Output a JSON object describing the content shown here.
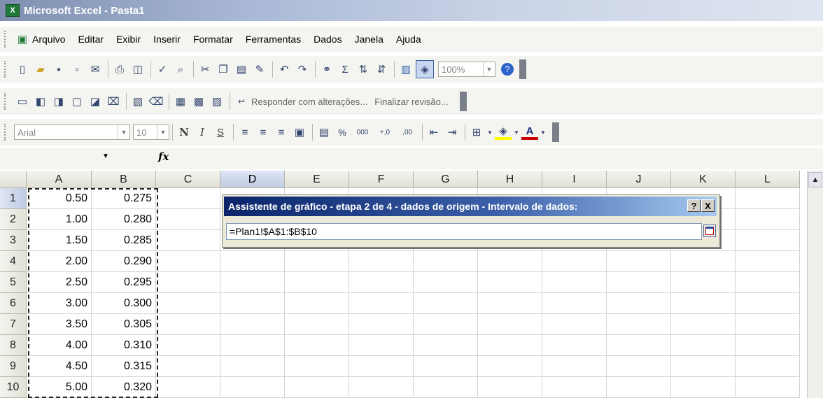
{
  "window": {
    "title": "Microsoft Excel - Pasta1",
    "app_icon": "X"
  },
  "menu": [
    "Arquivo",
    "Editar",
    "Exibir",
    "Inserir",
    "Formatar",
    "Ferramentas",
    "Dados",
    "Janela",
    "Ajuda"
  ],
  "toolbar": {
    "zoom": "100%",
    "review_reply": "Responder com alterações...",
    "review_end": "Finalizar revisão...",
    "font_name": "Arial",
    "font_size": "10",
    "bold": "N",
    "italic": "I",
    "underline": "S",
    "percent": "%",
    "thousands": "000",
    "inc_decimal": "+,0",
    "dec_decimal": ",00",
    "font_color_glyph": "A",
    "sum_glyph": "Σ"
  },
  "formula_bar": {
    "name_box": "",
    "fx": "fx"
  },
  "columns": [
    "A",
    "B",
    "C",
    "D",
    "E",
    "F",
    "G",
    "H",
    "I",
    "J",
    "K",
    "L"
  ],
  "rows": [
    "1",
    "2",
    "3",
    "4",
    "5",
    "6",
    "7",
    "8",
    "9",
    "10"
  ],
  "cells": {
    "A": [
      "0.50",
      "1.00",
      "1.50",
      "2.00",
      "2.50",
      "3.00",
      "3.50",
      "4.00",
      "4.50",
      "5.00"
    ],
    "B": [
      "0.275",
      "0.280",
      "0.285",
      "0.290",
      "0.295",
      "0.300",
      "0.305",
      "0.310",
      "0.315",
      "0.320"
    ]
  },
  "dialog": {
    "title": "Assistente de gráfico - etapa 2 de 4 - dados de origem - Intervalo de dados:",
    "help": "?",
    "close": "X",
    "range_value": "=Plan1!$A$1:$B$10"
  },
  "colors": {
    "selected_header": "#bfcbe3",
    "dialog_title": "#0a246a",
    "accent_red": "#cc0000"
  }
}
